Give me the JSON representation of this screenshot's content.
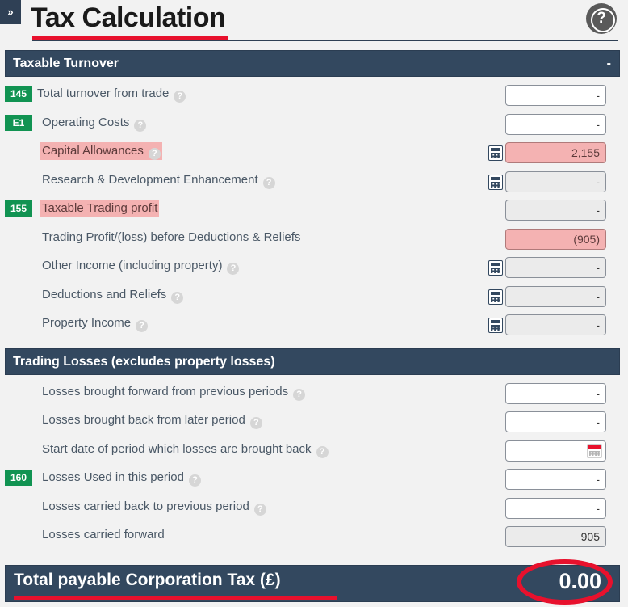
{
  "header": {
    "collapse_label": "»",
    "title": "Tax Calculation",
    "help_icon": "help-question-icon"
  },
  "sections": [
    {
      "title": "Taxable Turnover",
      "toggle": "-",
      "rows": [
        {
          "badge": "145",
          "label": "Total turnover from trade",
          "help": true,
          "indent": 0,
          "highlight": false,
          "calc": false,
          "field": {
            "value": "-",
            "state": "editable"
          }
        },
        {
          "badge": "E1",
          "label": "Operating Costs",
          "help": true,
          "indent": 1,
          "highlight": false,
          "calc": false,
          "field": {
            "value": "-",
            "state": "editable"
          }
        },
        {
          "badge": "",
          "label": "Capital Allowances",
          "help": true,
          "indent": 1,
          "highlight": true,
          "calc": true,
          "field": {
            "value": "2,155",
            "state": "pink"
          }
        },
        {
          "badge": "",
          "label": "Research & Development Enhancement",
          "help": true,
          "indent": 1,
          "highlight": false,
          "calc": true,
          "field": {
            "value": "-",
            "state": "readonly"
          }
        },
        {
          "badge": "155",
          "label": "Taxable Trading profit",
          "help": false,
          "indent": 1,
          "highlight": true,
          "calc": false,
          "field": {
            "value": "-",
            "state": "readonly"
          }
        },
        {
          "badge": "",
          "label": "Trading Profit/(loss) before Deductions & Reliefs",
          "help": false,
          "indent": 1,
          "highlight": false,
          "calc": false,
          "field": {
            "value": "(905)",
            "state": "pink"
          }
        },
        {
          "badge": "",
          "label": "Other Income (including property)",
          "help": true,
          "indent": 1,
          "highlight": false,
          "calc": true,
          "field": {
            "value": "-",
            "state": "readonly"
          }
        },
        {
          "badge": "",
          "label": "Deductions and Reliefs",
          "help": true,
          "indent": 1,
          "highlight": false,
          "calc": true,
          "field": {
            "value": "-",
            "state": "readonly"
          }
        },
        {
          "badge": "",
          "label": "Property Income",
          "help": true,
          "indent": 1,
          "highlight": false,
          "calc": true,
          "field": {
            "value": "-",
            "state": "readonly"
          }
        }
      ]
    },
    {
      "title": "Trading Losses (excludes property losses)",
      "toggle": "",
      "rows": [
        {
          "badge": "",
          "label": "Losses brought forward from previous periods",
          "help": true,
          "indent": 1,
          "highlight": false,
          "calc": false,
          "field": {
            "value": "-",
            "state": "editable"
          }
        },
        {
          "badge": "",
          "label": "Losses brought back from later period",
          "help": true,
          "indent": 1,
          "highlight": false,
          "calc": false,
          "field": {
            "value": "-",
            "state": "editable"
          }
        },
        {
          "badge": "",
          "label": "Start date of period which losses are brought back",
          "help": true,
          "indent": 1,
          "highlight": false,
          "calc": false,
          "field": {
            "value": "",
            "state": "date"
          }
        },
        {
          "badge": "160",
          "label": "Losses Used in this period",
          "help": true,
          "indent": 1,
          "highlight": false,
          "calc": false,
          "field": {
            "value": "-",
            "state": "editable"
          }
        },
        {
          "badge": "",
          "label": "Losses carried back to previous period",
          "help": true,
          "indent": 1,
          "highlight": false,
          "calc": false,
          "field": {
            "value": "-",
            "state": "editable"
          }
        },
        {
          "badge": "",
          "label": "Losses carried forward",
          "help": false,
          "indent": 1,
          "highlight": false,
          "calc": false,
          "field": {
            "value": "905",
            "state": "readonly"
          }
        }
      ]
    }
  ],
  "total": {
    "label": "Total payable Corporation Tax (£)",
    "value": "0.00"
  },
  "colors": {
    "section_bar": "#33485f",
    "badge_green": "#119352",
    "highlight_pink": "#f4b2b2",
    "accent_red": "#e8112d",
    "label_text": "#4a5866"
  }
}
